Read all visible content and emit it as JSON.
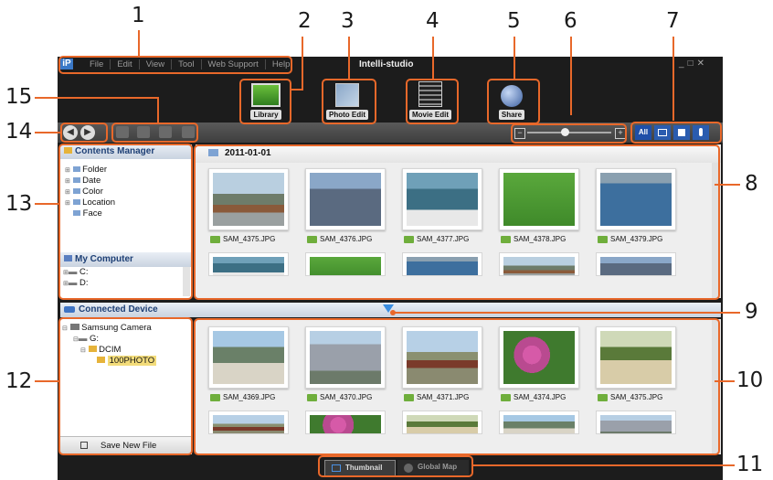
{
  "callouts": [
    "1",
    "2",
    "3",
    "4",
    "5",
    "6",
    "7",
    "8",
    "9",
    "10",
    "11",
    "12",
    "13",
    "14",
    "15"
  ],
  "app": {
    "title": "Intelli-studio",
    "menu": [
      "File",
      "Edit",
      "View",
      "Tool",
      "Web Support",
      "Help"
    ],
    "top_buttons": [
      "Library",
      "Photo Edit",
      "Movie Edit",
      "Share"
    ],
    "view_filters": [
      "All"
    ],
    "contents_manager": {
      "title": "Contents Manager",
      "items": [
        "Folder",
        "Date",
        "Color",
        "Location",
        "Face"
      ]
    },
    "my_computer": {
      "title": "My Computer",
      "items": [
        "C:",
        "D:"
      ]
    },
    "date_header": "2011-01-01",
    "library_files": [
      "SAM_4375.JPG",
      "SAM_4376.JPG",
      "SAM_4377.JPG",
      "SAM_4378.JPG",
      "SAM_4379.JPG"
    ],
    "connected_device": {
      "title": "Connected Device",
      "tree": [
        "Samsung Camera",
        "G:",
        "DCIM",
        "100PHOTO"
      ],
      "save_button": "Save New File"
    },
    "device_files": [
      "SAM_4369.JPG",
      "SAM_4370.JPG",
      "SAM_4371.JPG",
      "SAM_4374.JPG",
      "SAM_4375.JPG"
    ],
    "bottom_tabs": [
      "Thumbnail",
      "Global Map"
    ],
    "zoom_level": 0.45
  },
  "colors": {
    "accent": "#e8682a",
    "app_bg": "#1c1c1c",
    "panel_title": "#1d3f75",
    "selected": "#1f4fa8"
  }
}
